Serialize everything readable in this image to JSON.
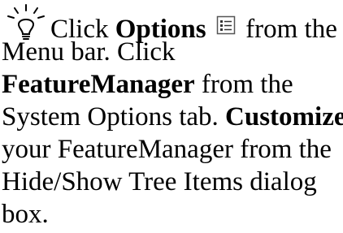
{
  "tip": {
    "icon": "lightbulb-icon",
    "line1": {
      "pre": "Click ",
      "b1": "Options",
      "post": " from the"
    },
    "line2": "Menu bar. Click",
    "line3": "FeatureManager",
    "line3_post": " from the",
    "line4_pre": "System Options tab. ",
    "line4_b": "Customize",
    "line5": "your FeatureManager from the",
    "line6": "Hide/Show Tree Items dialog",
    "line7": "box.",
    "options_icon": "options-icon"
  }
}
